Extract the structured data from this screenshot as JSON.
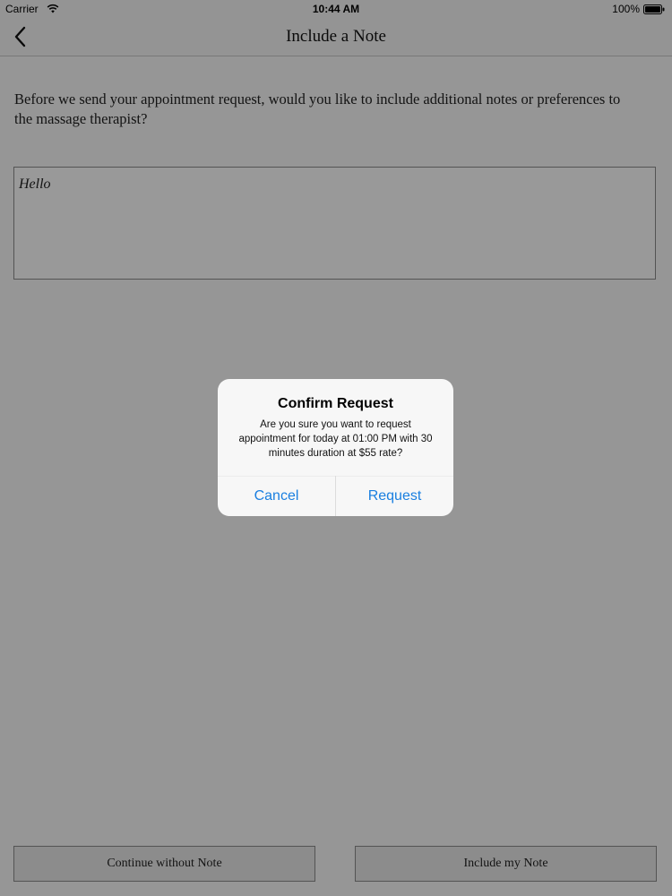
{
  "status_bar": {
    "carrier": "Carrier",
    "time": "10:44 AM",
    "battery": "100%",
    "wifi_icon": "wifi-icon",
    "battery_icon": "battery-icon"
  },
  "nav": {
    "title": "Include a Note",
    "back_icon": "chevron-left-icon"
  },
  "content": {
    "prompt": "Before we send your appointment request, would you like to include additional notes or preferences to the massage therapist?",
    "note_value": "Hello"
  },
  "buttons": {
    "continue_without": "Continue without Note",
    "include_note": "Include my Note"
  },
  "alert": {
    "title": "Confirm Request",
    "message": "Are you sure you want to request appointment for today at 01:00 PM with 30 minutes duration at $55 rate?",
    "cancel": "Cancel",
    "confirm": "Request"
  },
  "colors": {
    "accent": "#1a7fe0",
    "overlay": "rgba(0,0,0,0.40)"
  }
}
